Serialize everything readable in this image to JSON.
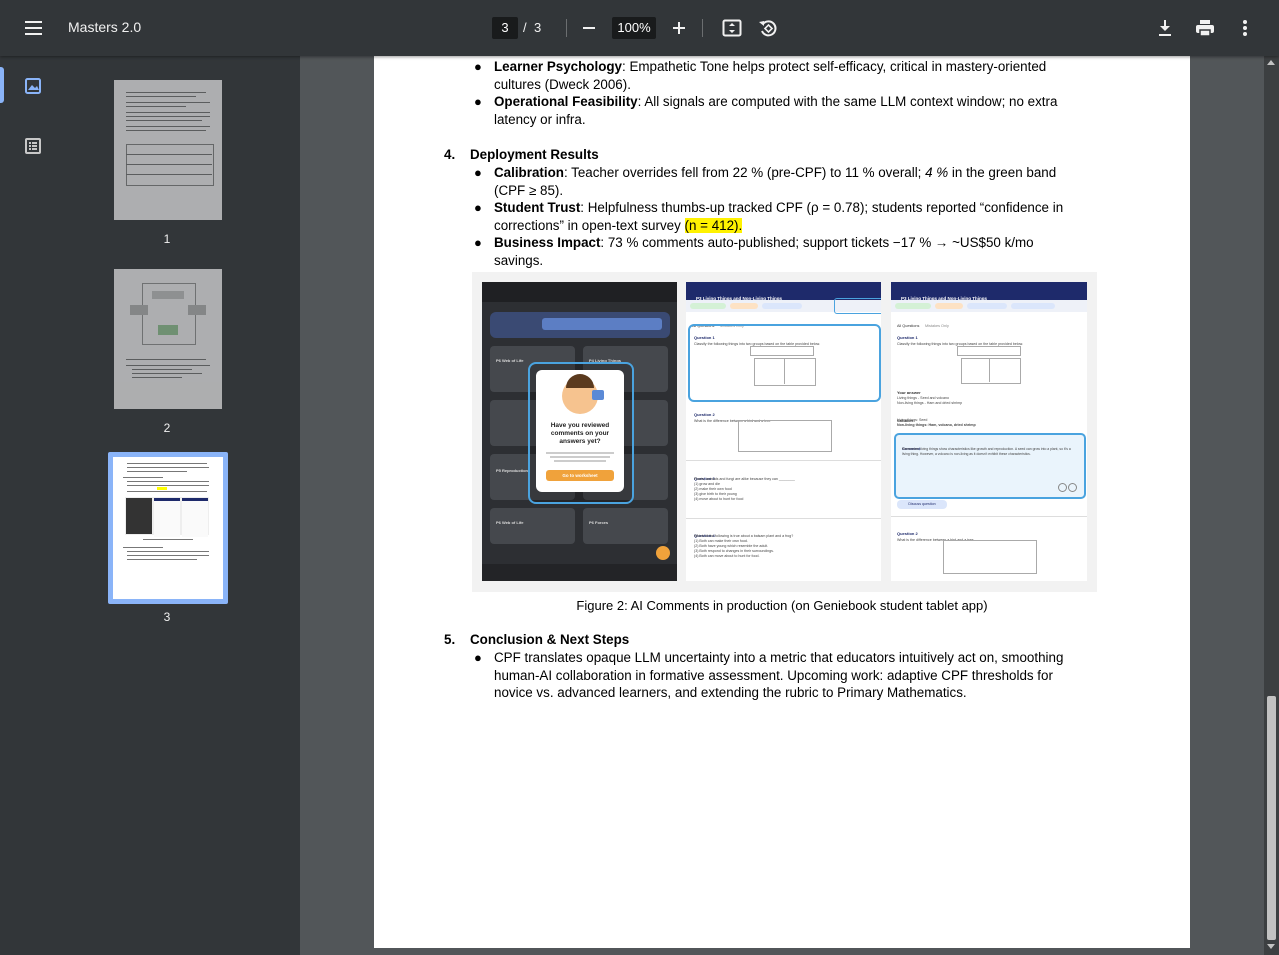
{
  "toolbar": {
    "title": "Masters 2.0",
    "page_current": "3",
    "page_separator": "/",
    "page_total": "3",
    "zoom": "100%"
  },
  "sidebar": {
    "thumbnails": [
      {
        "label": "1"
      },
      {
        "label": "2"
      },
      {
        "label": "3"
      }
    ]
  },
  "doc": {
    "top_bullets": [
      {
        "bold": "Learner Psychology",
        "text": ": Empathetic Tone helps protect self-efficacy, critical in mastery-oriented",
        "cont": "cultures (Dweck 2006)."
      },
      {
        "bold": "Operational Feasibility",
        "text": ": All signals are computed with the same LLM context window; no extra",
        "cont": "latency or infra."
      }
    ],
    "section4": {
      "num": "4.",
      "title": "Deployment Results",
      "b1_bold": "Calibration",
      "b1_text": ": Teacher overrides fell from 22 % (pre-CPF) to 11 % overall; ",
      "b1_italic": "4 %",
      "b1_text2": " in the green band",
      "b1_cont": "(CPF ≥ 85).",
      "b2_bold": "Student Trust",
      "b2_text": ": Helpfulness thumbs-up tracked CPF (ρ = 0.78); students reported “confidence in",
      "b2_cont": "corrections” in open-text survey ",
      "b2_highlight": "(n = 412).",
      "b3_bold": "Business Impact",
      "b3_text": ": 73 % comments auto-published; support tickets −17 % → ~US$50 k/mo",
      "b3_cont": "savings."
    },
    "figure": {
      "caption": "Figure 2: AI Comments in production (on Geniebook student tablet app)",
      "left": {
        "modal_l1": "Have you reviewed",
        "modal_l2": "comments on your",
        "modal_l3": "answers yet?",
        "modal_button": "Go to worksheet",
        "tile_1": "P6 Web of Life",
        "tile_2": "P4 Living Things",
        "tile_3": "P5 Reproduction",
        "tile_4": "P6 Web of Life",
        "tile_5": "P6 Forces"
      },
      "middle": {
        "header": "P3 Living Things and Non-Living Things",
        "tab_all": "All Questions",
        "tab_mistakes": "Mistakes Only",
        "q1": "Question 1",
        "q1_text": "Classify the following things into two groups based on the table provided below.",
        "q2": "Question 2",
        "q2_text": "What is the difference between a bird and a tree",
        "q3": "Question 3",
        "q3_text": "Plants, animals and fungi are alike because they can ________",
        "q3_opt1": "(1) grow and die",
        "q3_opt2": "(2) make their own food",
        "q3_opt3": "(3) give birth to their young",
        "q3_opt4": "(4) move about to hunt for food",
        "q4": "Question 4",
        "q4_text": "Which of the following is true about a balsam plant and a frog?",
        "q4_opt1": "(1) Both can make their own food.",
        "q4_opt2": "(2) Both have young which resemble the adult.",
        "q4_opt3": "(3) Both respond to changes in their surroundings.",
        "q4_opt4": "(4) Both can move about to hunt for food."
      },
      "right": {
        "header": "P3 Living Things and Non-Living Things",
        "tab_all": "All Questions",
        "tab_mistakes": "Mistakes Only",
        "q1": "Question 1",
        "q1_text": "Classify the following things into two groups based on the table provided below.",
        "your_answer": "Your answer",
        "ans1": "Living things - Seed and volcano",
        "ans2": "Non-living things - Ham and dried shrimp",
        "solution": "Solution",
        "sol1": "Living things: Seed",
        "sol2": "Non-living things: Ham, volcano, dried shrimp",
        "comment_title": "Comment",
        "comment_text": "Remember, living things show characteristics like growth and reproduction. A seed can grow into a plant, so it's a living thing. However, a volcano is non-living as it doesn't exhibit these characteristics.",
        "discuss": "Discuss question",
        "q2": "Question 2",
        "q2_text": "What is the difference between a bird and a tree"
      }
    },
    "section5": {
      "num": "5.",
      "title": "Conclusion & Next Steps",
      "l1": "CPF translates opaque LLM uncertainty into a metric that educators intuitively act on, smoothing",
      "l2": "human-AI collaboration in formative assessment. Upcoming work: adaptive CPF thresholds for",
      "l3": "novice vs. advanced learners, and extending the rubric to Primary Mathematics."
    }
  },
  "colors": {
    "toolbar_bg": "#323639",
    "viewer_bg": "#525659",
    "accent": "#8ab4f8",
    "highlight": "#fff200"
  }
}
